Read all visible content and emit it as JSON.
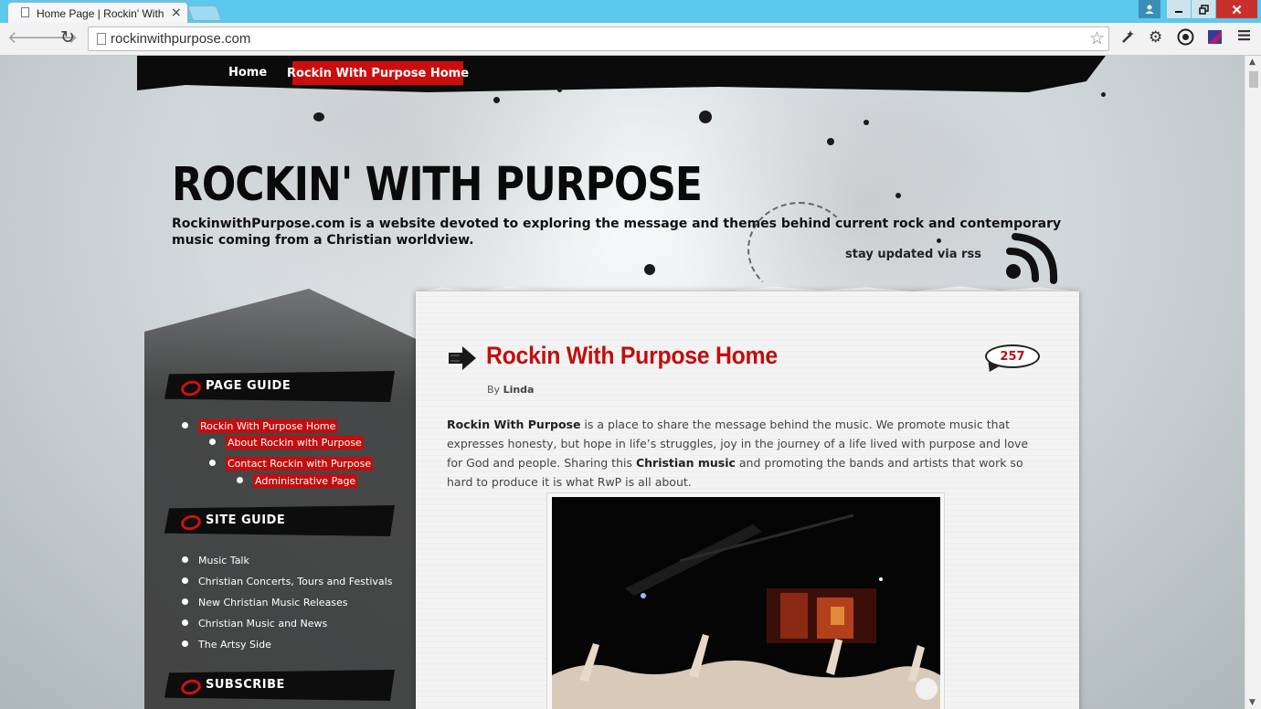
{
  "browser": {
    "tab_title": "Home Page | Rockin' With",
    "tab_close": "×",
    "url": "rockinwithpurpose.com",
    "icons": [
      "back-icon",
      "forward-icon",
      "reload-icon",
      "page-icon",
      "bookmark-star-icon",
      "extension-icon",
      "settings-gear-icon",
      "circle-extension-icon",
      "ribbon-extension-icon",
      "menu-icon"
    ],
    "window_buttons": {
      "user": "user-icon",
      "minimize": "minimize-icon",
      "maximize": "restore-icon",
      "close": "close-icon"
    }
  },
  "nav": {
    "home_label": "Home",
    "active_label": "Rockin With Purpose Home"
  },
  "header": {
    "title": "ROCKIN' WITH PURPOSE",
    "description": "RockinwithPurpose.com is a website devoted to exploring the message and themes behind current rock and contemporary music coming from a Christian worldview.",
    "rss_text": "stay updated via rss"
  },
  "sidebar": {
    "page_guide": {
      "title": "PAGE GUIDE",
      "items": [
        {
          "label": "Rockin With Purpose Home",
          "level": 0
        },
        {
          "label": "About Rockin with Purpose",
          "level": 1
        },
        {
          "label": "Contact Rockin with Purpose",
          "level": 1
        },
        {
          "label": "Administrative Page",
          "level": 2
        }
      ]
    },
    "site_guide": {
      "title": "SITE GUIDE",
      "items": [
        {
          "label": "Music Talk"
        },
        {
          "label": "Christian Concerts, Tours and Festivals"
        },
        {
          "label": "New Christian Music Releases"
        },
        {
          "label": "Christian Music and News"
        },
        {
          "label": "The Artsy Side"
        }
      ]
    },
    "subscribe": {
      "title": "SUBSCRIBE"
    }
  },
  "post": {
    "title": "Rockin With Purpose Home",
    "comment_count": "257",
    "byline_prefix": "By",
    "author": "Linda",
    "body": {
      "lead_bold": "Rockin With Purpose",
      "text1": " is a place to share the message behind the music. We promote music that expresses honesty, but hope in life’s struggles, joy in the journey of a life lived with purpose and love for God and people.  Sharing this ",
      "bold2": "Christian music",
      "text2": " and promoting the bands and artists that work so hard to produce it is what RwP is all about."
    }
  },
  "colors": {
    "accent_red": "#c40d0d",
    "chrome_blue": "#5bc8ec",
    "header_black": "#0b0b0b"
  }
}
